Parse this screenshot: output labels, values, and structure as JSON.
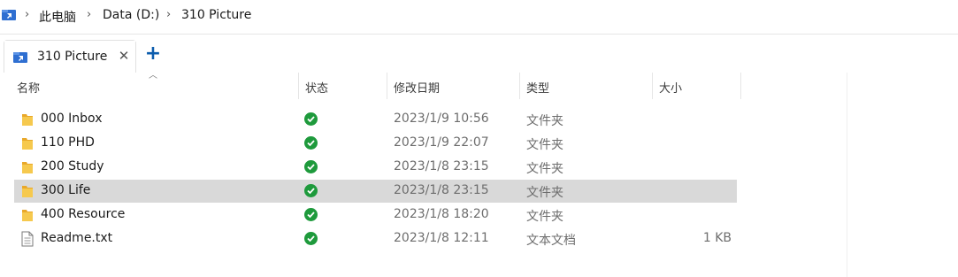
{
  "breadcrumb": {
    "root_icon": "this-pc-icon",
    "items": [
      "此电脑",
      "Data (D:)",
      "310 Picture"
    ]
  },
  "tabs": [
    {
      "label": "310 Picture",
      "icon": "folder-pin-icon",
      "close": "✕"
    }
  ],
  "add_tab_label": "+",
  "columns": {
    "name": "名称",
    "status": "状态",
    "modified": "修改日期",
    "type": "类型",
    "size": "大小"
  },
  "files": [
    {
      "name": "000 Inbox",
      "kind": "folder",
      "modified": "2023/1/9 10:56",
      "type": "文件夹",
      "size": ""
    },
    {
      "name": "110 PHD",
      "kind": "folder",
      "modified": "2023/1/9 22:07",
      "type": "文件夹",
      "size": ""
    },
    {
      "name": "200 Study",
      "kind": "folder",
      "modified": "2023/1/8 23:15",
      "type": "文件夹",
      "size": ""
    },
    {
      "name": "300 Life",
      "kind": "folder",
      "modified": "2023/1/8 23:15",
      "type": "文件夹",
      "size": "",
      "selected": true
    },
    {
      "name": "400 Resource",
      "kind": "folder",
      "modified": "2023/1/8 18:20",
      "type": "文件夹",
      "size": ""
    },
    {
      "name": "Readme.txt",
      "kind": "text-file",
      "modified": "2023/1/8 12:11",
      "type": "文本文档",
      "size": "1 KB"
    }
  ],
  "colors": {
    "folder": "#f3c13a",
    "status_ok": "#1e9a3c",
    "selected_row": "#d9d9d9",
    "accent": "#0b5cad"
  }
}
